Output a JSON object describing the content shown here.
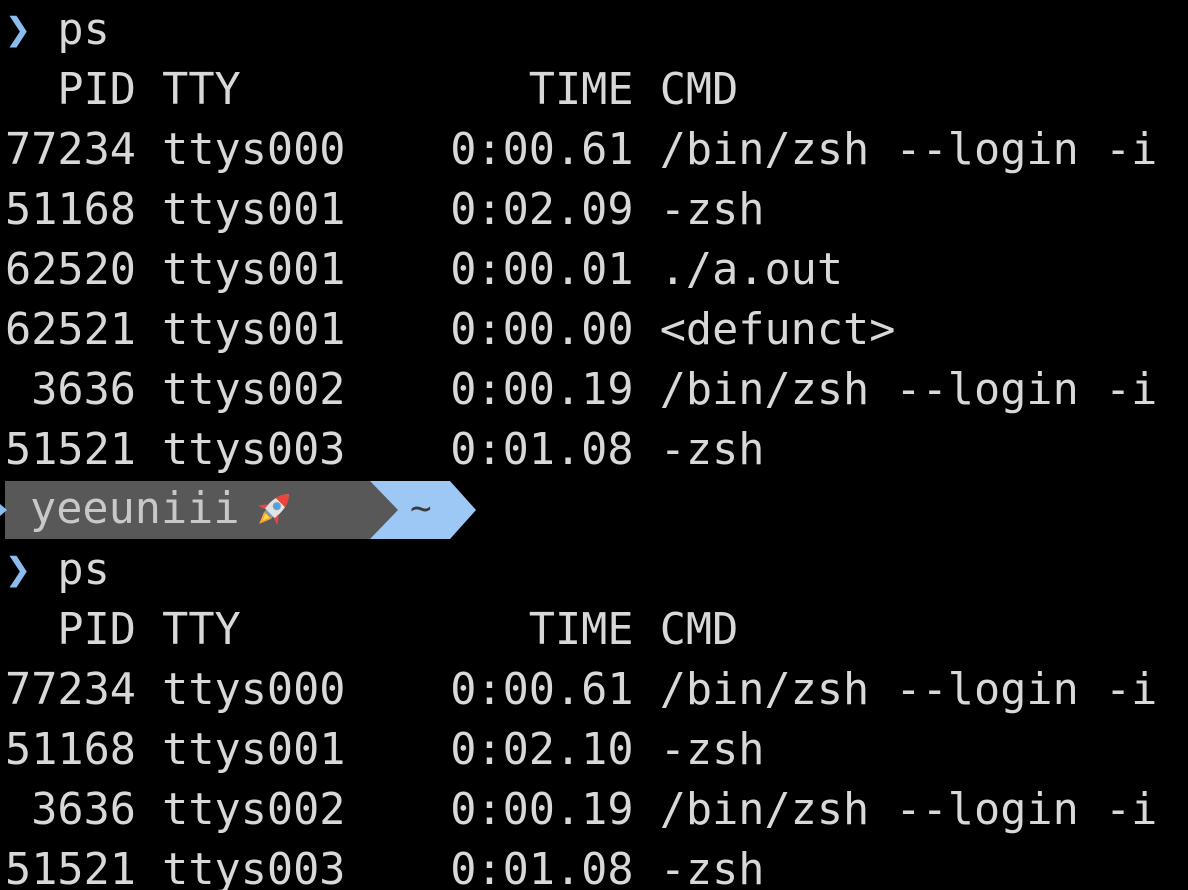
{
  "prompt_symbol": "❯",
  "blocks": [
    {
      "command": "ps",
      "header": "  PID TTY           TIME CMD",
      "rows": [
        "77234 ttys000    0:00.61 /bin/zsh --login -i",
        "51168 ttys001    0:02.09 -zsh",
        "62520 ttys001    0:00.01 ./a.out",
        "62521 ttys001    0:00.00 <defunct>",
        " 3636 ttys002    0:00.19 /bin/zsh --login -i",
        "51521 ttys003    0:01.08 -zsh"
      ]
    },
    {
      "command": "ps",
      "header": "  PID TTY           TIME CMD",
      "rows": [
        "77234 ttys000    0:00.61 /bin/zsh --login -i",
        "51168 ttys001    0:02.10 -zsh",
        " 3636 ttys002    0:00.19 /bin/zsh --login -i",
        "51521 ttys003    0:01.08 -zsh"
      ]
    }
  ],
  "powerline": {
    "user": "yeeuniii",
    "user_icon": "rocket-icon",
    "directory": "~"
  },
  "colors": {
    "background": "#000000",
    "text": "#d8d8d8",
    "prompt": "#8bbcf0",
    "segment_user_bg": "#585858",
    "segment_dir_bg": "#9dc8f5"
  }
}
